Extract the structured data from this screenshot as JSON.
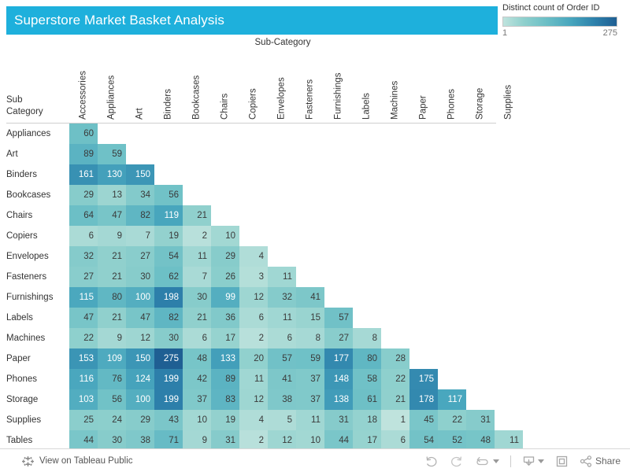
{
  "title": "Superstore Market Basket Analysis",
  "legend": {
    "title": "Distinct count of Order ID",
    "min": "1",
    "max": "275"
  },
  "column_axis_title": "Sub-Category",
  "row_axis_title_line1": "Sub",
  "row_axis_title_line2": "Category",
  "toolbar": {
    "tableau_public_label": "View on Tableau Public",
    "share_label": "Share",
    "undo_icon": "undo-icon",
    "redo_icon": "redo-icon",
    "reset_icon": "reset-icon",
    "download_icon": "download-icon",
    "fullscreen_icon": "fullscreen-icon",
    "share_icon": "share-icon",
    "tableau_icon": "tableau-logo-icon"
  },
  "chart_data": {
    "type": "heatmap",
    "title": "Superstore Market Basket Analysis",
    "xlabel": "Sub-Category",
    "ylabel": "Sub Category",
    "value_label": "Distinct count of Order ID",
    "color_scale": {
      "min": 1,
      "max": 275,
      "stops": [
        "#bfe3dd",
        "#8fd0cd",
        "#6cbfc6",
        "#47a5bd",
        "#2e82ac",
        "#1f5f93"
      ]
    },
    "columns": [
      "Accessories",
      "Appliances",
      "Art",
      "Binders",
      "Bookcases",
      "Chairs",
      "Copiers",
      "Envelopes",
      "Fasteners",
      "Furnishings",
      "Labels",
      "Machines",
      "Paper",
      "Phones",
      "Storage",
      "Supplies"
    ],
    "rows": [
      "Appliances",
      "Art",
      "Binders",
      "Bookcases",
      "Chairs",
      "Copiers",
      "Envelopes",
      "Fasteners",
      "Furnishings",
      "Labels",
      "Machines",
      "Paper",
      "Phones",
      "Storage",
      "Supplies",
      "Tables"
    ],
    "matrix": [
      [
        60
      ],
      [
        89,
        59
      ],
      [
        161,
        130,
        150
      ],
      [
        29,
        13,
        34,
        56
      ],
      [
        64,
        47,
        82,
        119,
        21
      ],
      [
        6,
        9,
        7,
        19,
        2,
        10
      ],
      [
        32,
        21,
        27,
        54,
        11,
        29,
        4
      ],
      [
        27,
        21,
        30,
        62,
        7,
        26,
        3,
        11
      ],
      [
        115,
        80,
        100,
        198,
        30,
        99,
        12,
        32,
        41
      ],
      [
        47,
        21,
        47,
        82,
        21,
        36,
        6,
        11,
        15,
        57
      ],
      [
        22,
        9,
        12,
        30,
        6,
        17,
        2,
        6,
        8,
        27,
        8
      ],
      [
        153,
        109,
        150,
        275,
        48,
        133,
        20,
        57,
        59,
        177,
        80,
        28
      ],
      [
        116,
        76,
        124,
        199,
        42,
        89,
        11,
        41,
        37,
        148,
        58,
        22,
        175
      ],
      [
        103,
        56,
        100,
        199,
        37,
        83,
        12,
        38,
        37,
        138,
        61,
        21,
        178,
        117
      ],
      [
        25,
        24,
        29,
        43,
        10,
        19,
        4,
        5,
        11,
        31,
        18,
        1,
        45,
        22,
        31
      ],
      [
        44,
        30,
        38,
        71,
        9,
        31,
        2,
        12,
        10,
        44,
        17,
        6,
        54,
        52,
        48,
        11
      ]
    ]
  }
}
